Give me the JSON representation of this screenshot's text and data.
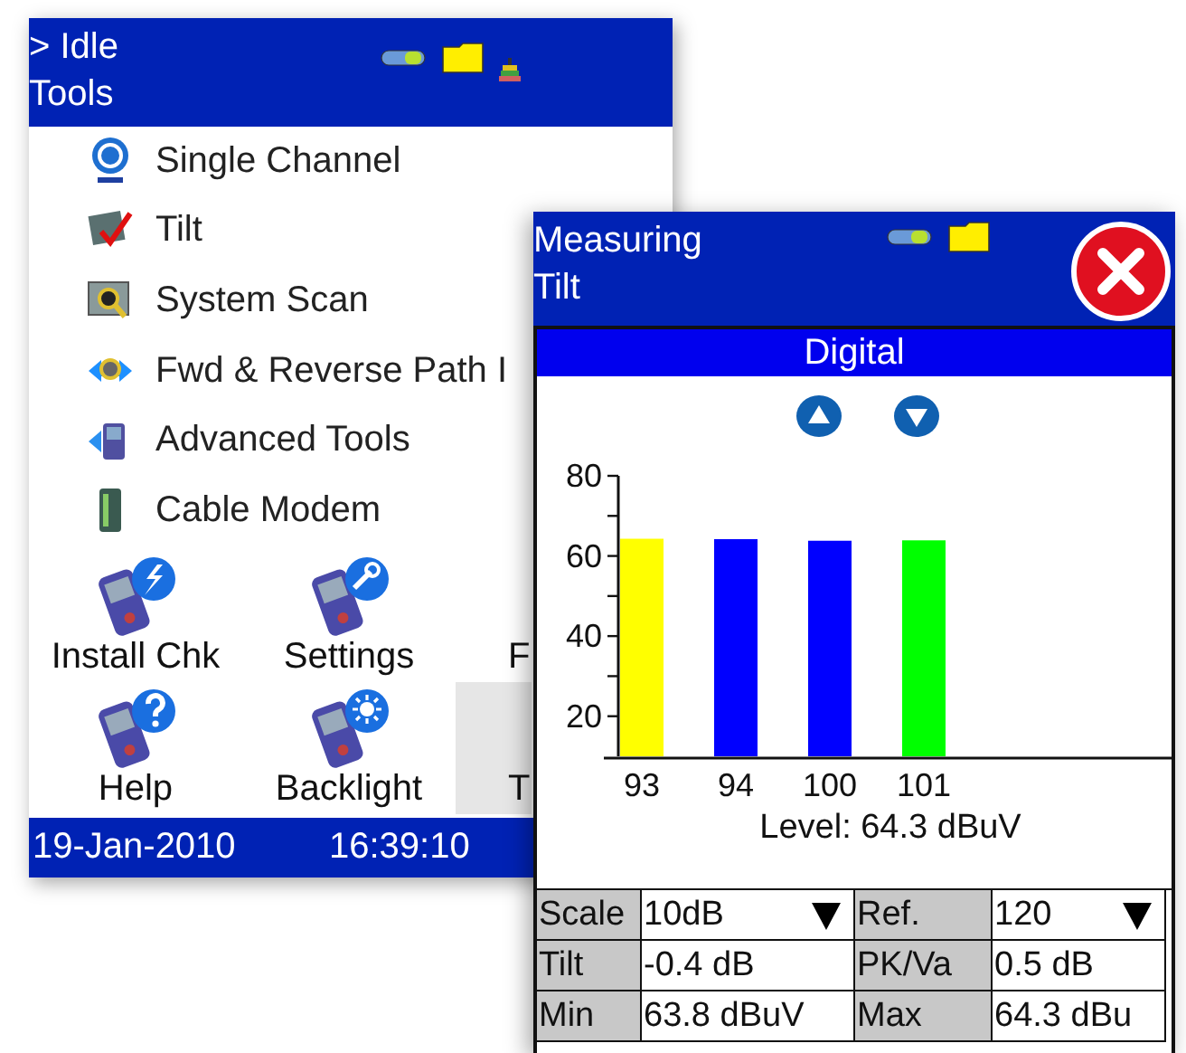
{
  "back_window": {
    "title_lines": [
      "> Idle",
      "Tools"
    ],
    "menu": [
      {
        "label": "Single Channel"
      },
      {
        "label": "Tilt"
      },
      {
        "label": "System Scan"
      },
      {
        "label": "Fwd & Reverse Path I"
      },
      {
        "label": "Advanced Tools"
      },
      {
        "label": "Cable Modem"
      }
    ],
    "tiles": [
      {
        "label": "Install Chk",
        "selected": false
      },
      {
        "label": "Settings",
        "selected": false
      },
      {
        "label": "F",
        "selected": false
      },
      {
        "label": "Help",
        "selected": false
      },
      {
        "label": "Backlight",
        "selected": false
      },
      {
        "label": "T",
        "selected": true
      }
    ],
    "status_bar": {
      "date": "19-Jan-2010",
      "time": "16:39:10"
    }
  },
  "front_window": {
    "title_lines": [
      "Measuring",
      "Tilt"
    ],
    "panel_title": "Digital",
    "chart_data": {
      "type": "bar",
      "categories": [
        "93",
        "94",
        "100",
        "101"
      ],
      "series": [
        {
          "colors": [
            "#ffff00",
            "#0000ff",
            "#0000ff",
            "#00ff00"
          ],
          "values": [
            64.3,
            64.2,
            63.8,
            63.9
          ]
        }
      ],
      "ylim": [
        10,
        80
      ],
      "yticks": [
        20,
        40,
        60,
        80
      ]
    },
    "level_text": "Level: 64.3 dBuV",
    "table": [
      [
        {
          "kind": "label",
          "text": "Scale"
        },
        {
          "kind": "dropdown",
          "text": "10dB"
        },
        {
          "kind": "label",
          "text": "Ref."
        },
        {
          "kind": "dropdown",
          "text": "120"
        }
      ],
      [
        {
          "kind": "label",
          "text": "Tilt"
        },
        {
          "kind": "value",
          "text": "-0.4 dB"
        },
        {
          "kind": "label",
          "text": "PK/Va"
        },
        {
          "kind": "value",
          "text": "0.5 dB"
        }
      ],
      [
        {
          "kind": "label",
          "text": "Min"
        },
        {
          "kind": "value",
          "text": "63.8 dBuV"
        },
        {
          "kind": "label",
          "text": "Max"
        },
        {
          "kind": "value",
          "text": "64.3 dBu"
        }
      ]
    ]
  }
}
